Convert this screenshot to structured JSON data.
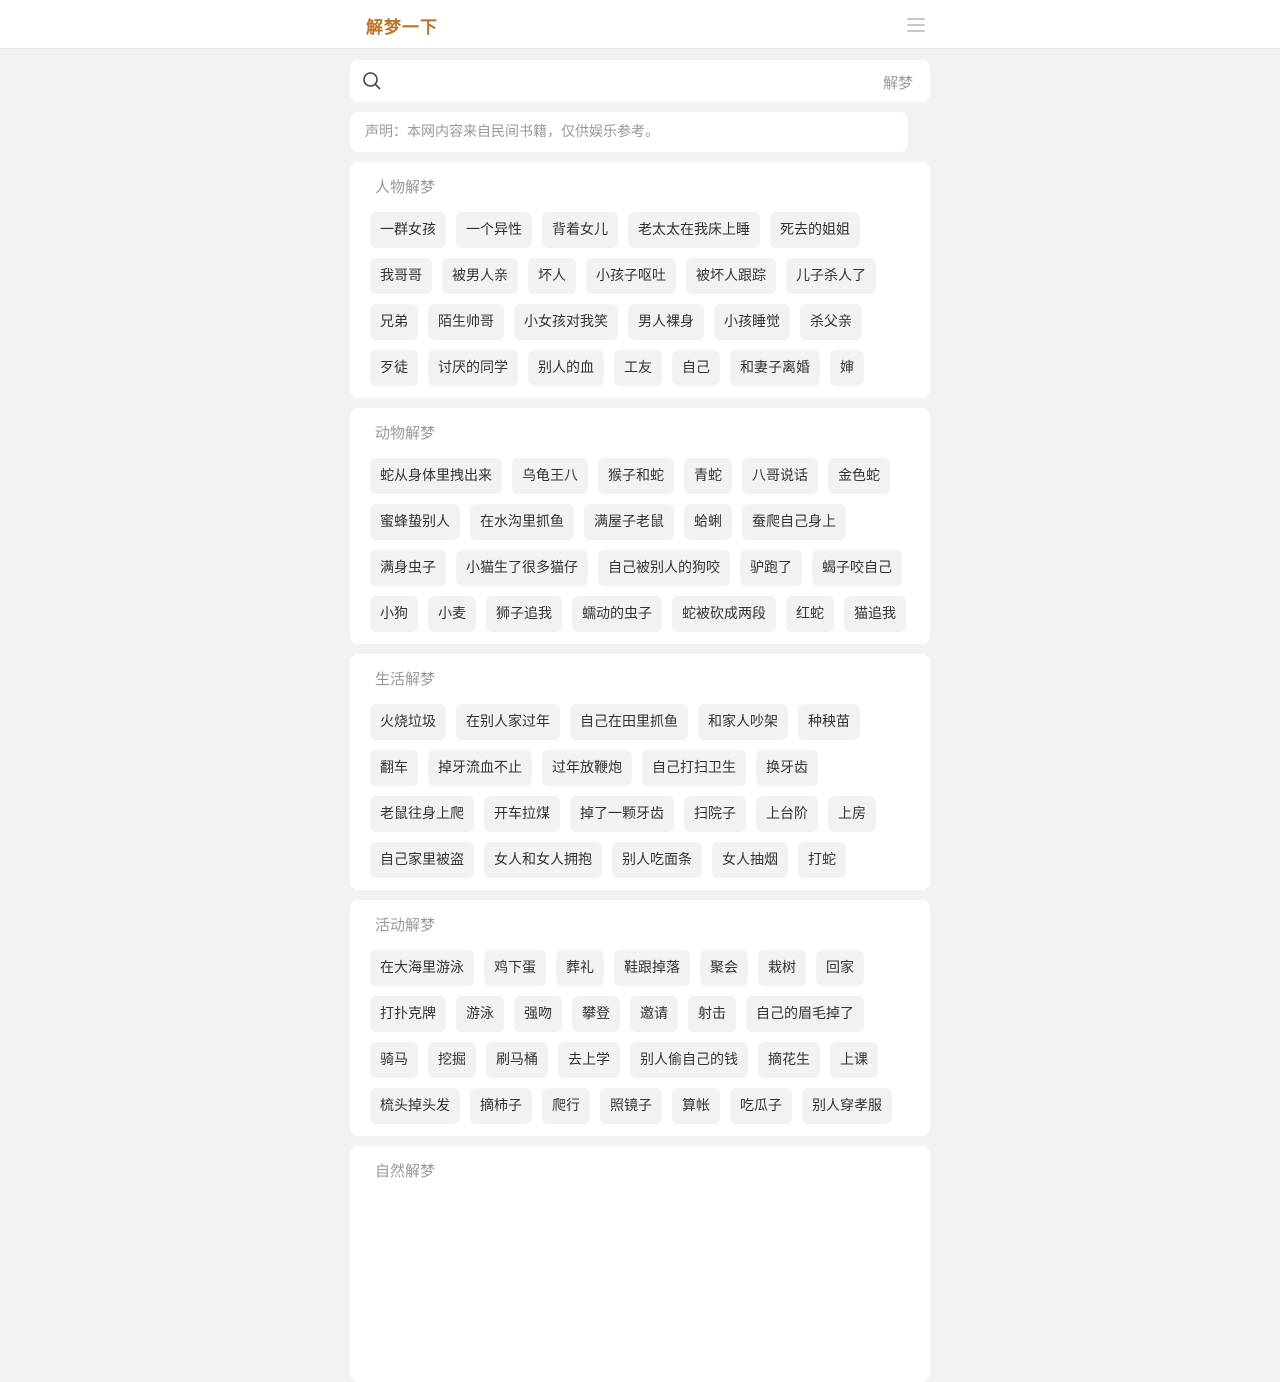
{
  "header": {
    "logo": "解梦一下"
  },
  "search": {
    "placeholder": "",
    "value": "",
    "button": "解梦"
  },
  "notice": "声明：本网内容来自民间书籍，仅供娱乐参考。",
  "sections": [
    {
      "title": "人物解梦",
      "tags": [
        "一群女孩",
        "一个异性",
        "背着女儿",
        "老太太在我床上睡",
        "死去的姐姐",
        "我哥哥",
        "被男人亲",
        "坏人",
        "小孩子呕吐",
        "被坏人跟踪",
        "儿子杀人了",
        "兄弟",
        "陌生帅哥",
        "小女孩对我笑",
        "男人裸身",
        "小孩睡觉",
        "杀父亲",
        "歹徒",
        "讨厌的同学",
        "别人的血",
        "工友",
        "自己",
        "和妻子离婚",
        "婶"
      ]
    },
    {
      "title": "动物解梦",
      "tags": [
        "蛇从身体里拽出来",
        "乌龟王八",
        "猴子和蛇",
        "青蛇",
        "八哥说话",
        "金色蛇",
        "蜜蜂蛰别人",
        "在水沟里抓鱼",
        "满屋子老鼠",
        "蛤蜊",
        "蚕爬自己身上",
        "满身虫子",
        "小猫生了很多猫仔",
        "自己被别人的狗咬",
        "驴跑了",
        "蝎子咬自己",
        "小狗",
        "小麦",
        "狮子追我",
        "蠕动的虫子",
        "蛇被砍成两段",
        "红蛇",
        "猫追我"
      ]
    },
    {
      "title": "生活解梦",
      "tags": [
        "火烧垃圾",
        "在别人家过年",
        "自己在田里抓鱼",
        "和家人吵架",
        "种秧苗",
        "翻车",
        "掉牙流血不止",
        "过年放鞭炮",
        "自己打扫卫生",
        "换牙齿",
        "老鼠往身上爬",
        "开车拉煤",
        "掉了一颗牙齿",
        "扫院子",
        "上台阶",
        "上房",
        "自己家里被盗",
        "女人和女人拥抱",
        "别人吃面条",
        "女人抽烟",
        "打蛇"
      ]
    },
    {
      "title": "活动解梦",
      "tags": [
        "在大海里游泳",
        "鸡下蛋",
        "葬礼",
        "鞋跟掉落",
        "聚会",
        "栽树",
        "回家",
        "打扑克牌",
        "游泳",
        "强吻",
        "攀登",
        "邀请",
        "射击",
        "自己的眉毛掉了",
        "骑马",
        "挖掘",
        "刷马桶",
        "去上学",
        "别人偷自己的钱",
        "摘花生",
        "上课",
        "梳头掉头发",
        "摘柿子",
        "爬行",
        "照镜子",
        "算帐",
        "吃瓜子",
        "别人穿孝服"
      ]
    },
    {
      "title": "自然解梦",
      "tags": []
    }
  ]
}
